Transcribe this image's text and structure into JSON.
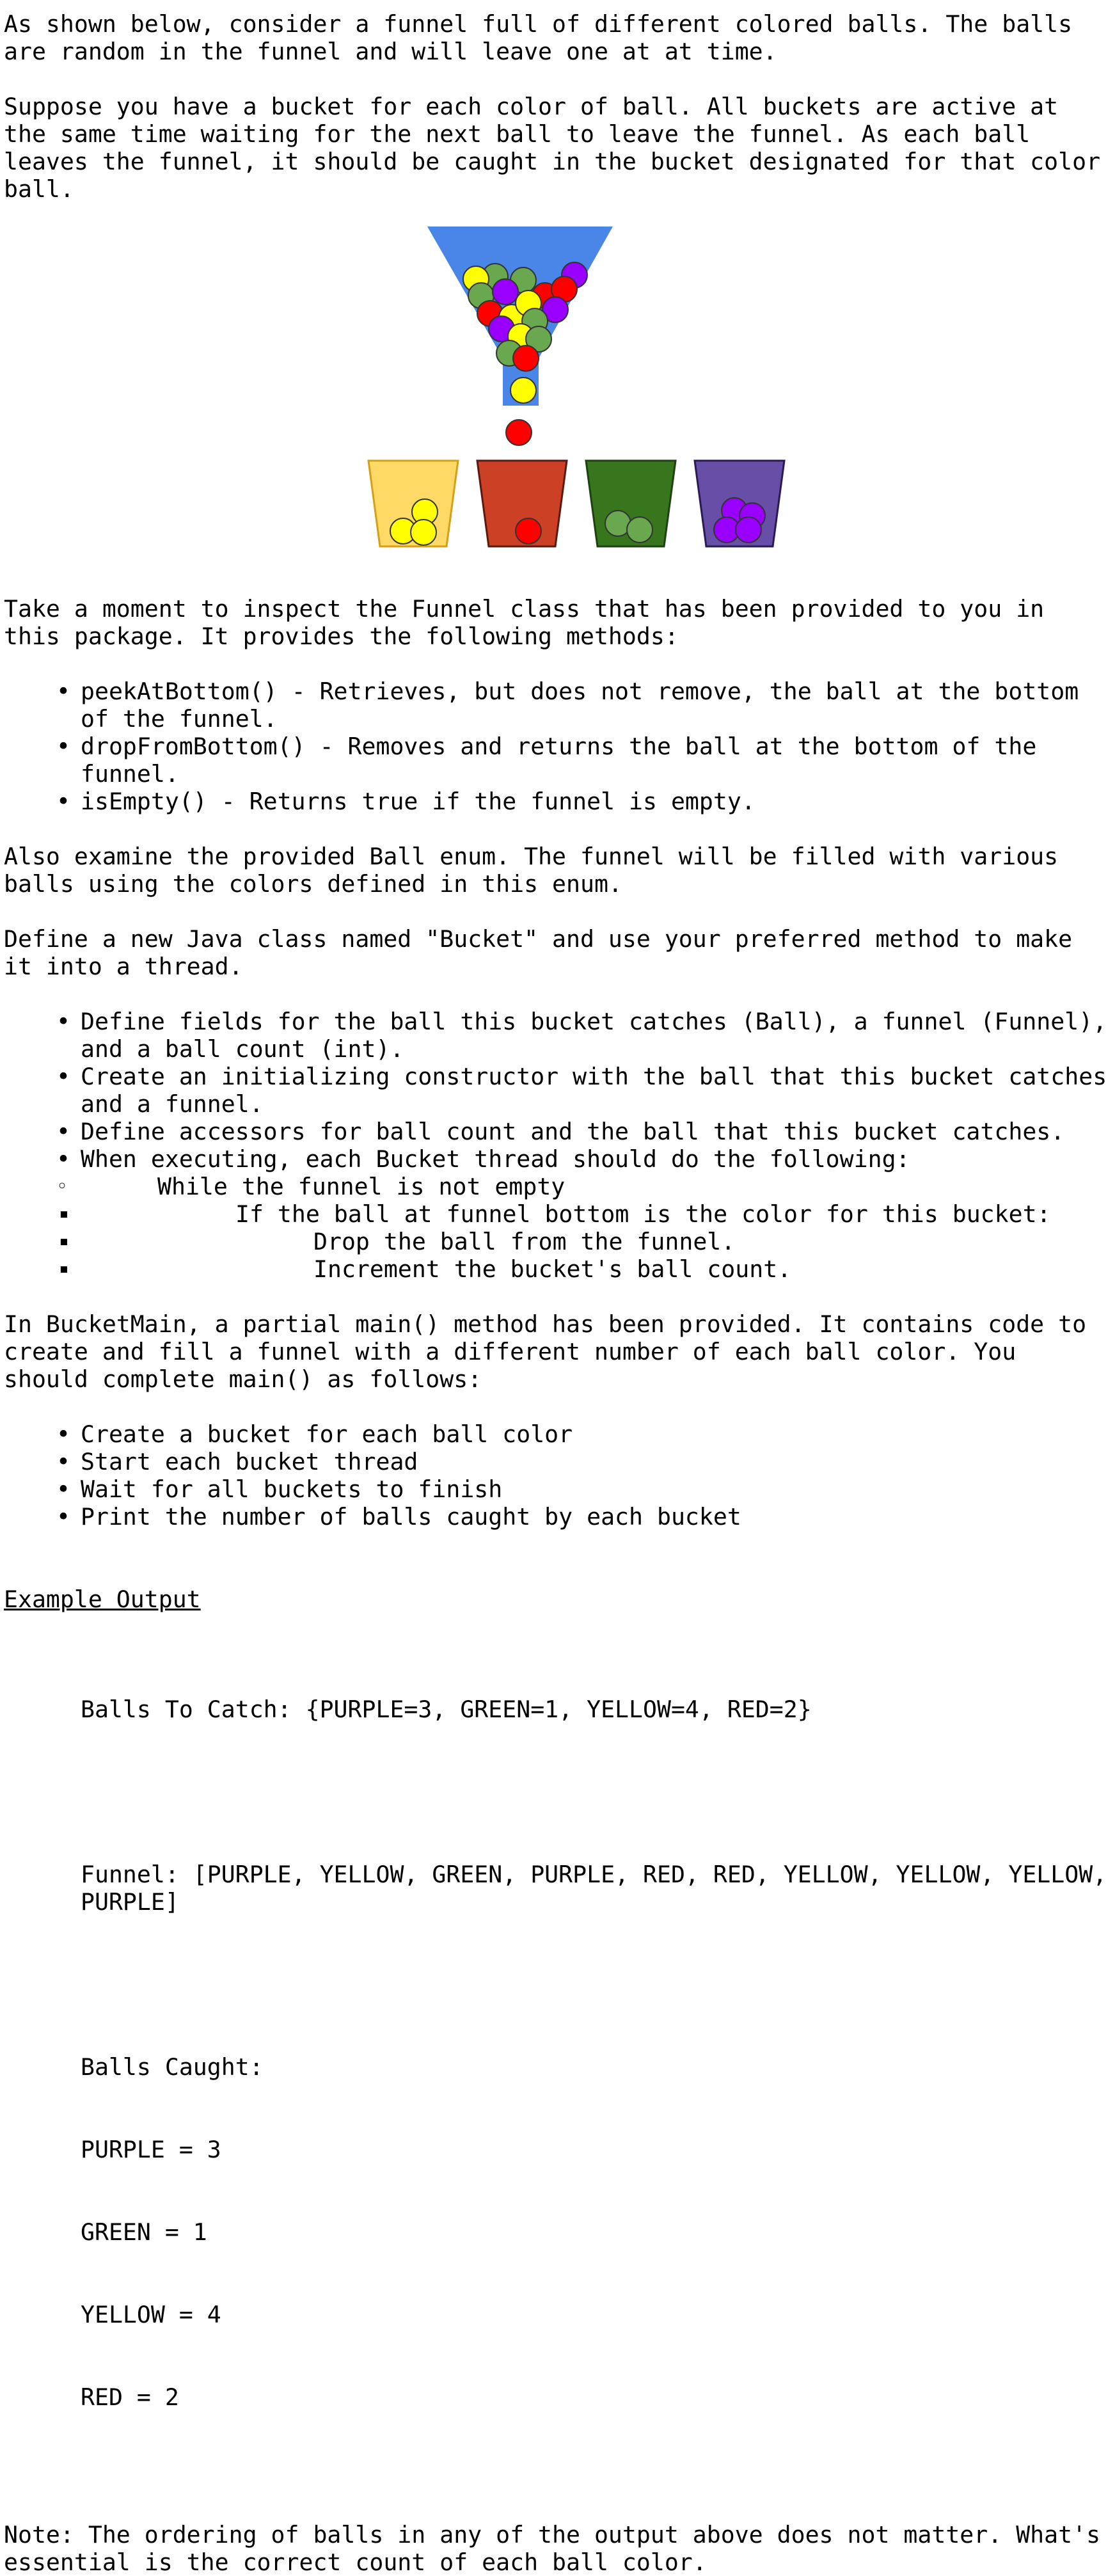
{
  "intro": {
    "p1": "As shown below, consider a funnel full of different colored balls. The balls are random in the funnel and will leave one at at time.",
    "p2": "Suppose you have a bucket for each color of ball. All buckets are active at the same time waiting for the next ball to leave the funnel. As each ball leaves the funnel, it should be caught in the bucket designated for that color ball."
  },
  "figure": {
    "colors": {
      "funnel": "#4a86e8",
      "yellow": "#ffff00",
      "red": "#ff0000",
      "green": "#6aa84f",
      "purple": "#9900ff",
      "bucket_yellow": "#ffd966",
      "bucket_red": "#cc4125",
      "bucket_green": "#38761d",
      "bucket_purple": "#674ea7"
    }
  },
  "funnel_section": {
    "intro": "Take a moment to inspect the Funnel class that has been provided to you in this package. It provides the following methods:",
    "methods": [
      "peekAtBottom() - Retrieves, but does not remove, the ball at the bottom of the funnel.",
      "dropFromBottom() - Removes and returns the ball at the bottom of the funnel.",
      "isEmpty() - Returns true if the funnel is empty."
    ],
    "enum_note": "Also examine the provided Ball enum. The funnel will be filled with various balls using the colors defined in this enum."
  },
  "bucket_section": {
    "intro": "Define a new Java class named \"Bucket\" and use your preferred method to make it into a thread.",
    "items": [
      "Define fields for the ball this bucket catches (Ball), a funnel (Funnel), and a ball count (int).",
      "Create an initializing constructor with the ball that this bucket catches and a funnel.",
      "Define accessors for ball count and the ball that this bucket catches.",
      "When executing, each Bucket thread should do the following:"
    ],
    "while_item": "While the funnel is not empty",
    "if_item": "If the ball at funnel bottom is the color for this bucket:",
    "actions": [
      "Drop the ball from the funnel.",
      "Increment the bucket's ball count."
    ]
  },
  "main_section": {
    "intro": "In BucketMain, a partial main() method has been provided. It contains code to create and fill a funnel with a different number of each ball color. You should complete main() as follows:",
    "items": [
      "Create a bucket for each ball color",
      "Start each bucket thread",
      "Wait for all buckets to finish",
      "Print the number of balls caught by each bucket"
    ]
  },
  "example": {
    "heading": "Example Output",
    "balls_to_catch": "Balls To Catch: {PURPLE=3, GREEN=1, YELLOW=4, RED=2}",
    "funnel": "Funnel: [PURPLE, YELLOW, GREEN, PURPLE, RED, RED, YELLOW, YELLOW, YELLOW, PURPLE]",
    "caught_title": "Balls Caught:",
    "caught": [
      "PURPLE = 3",
      "GREEN = 1",
      "YELLOW = 4",
      "RED = 2"
    ]
  },
  "note": "Note: The ordering of balls in any of the output above does not matter. What's essential is the correct count of each ball color."
}
